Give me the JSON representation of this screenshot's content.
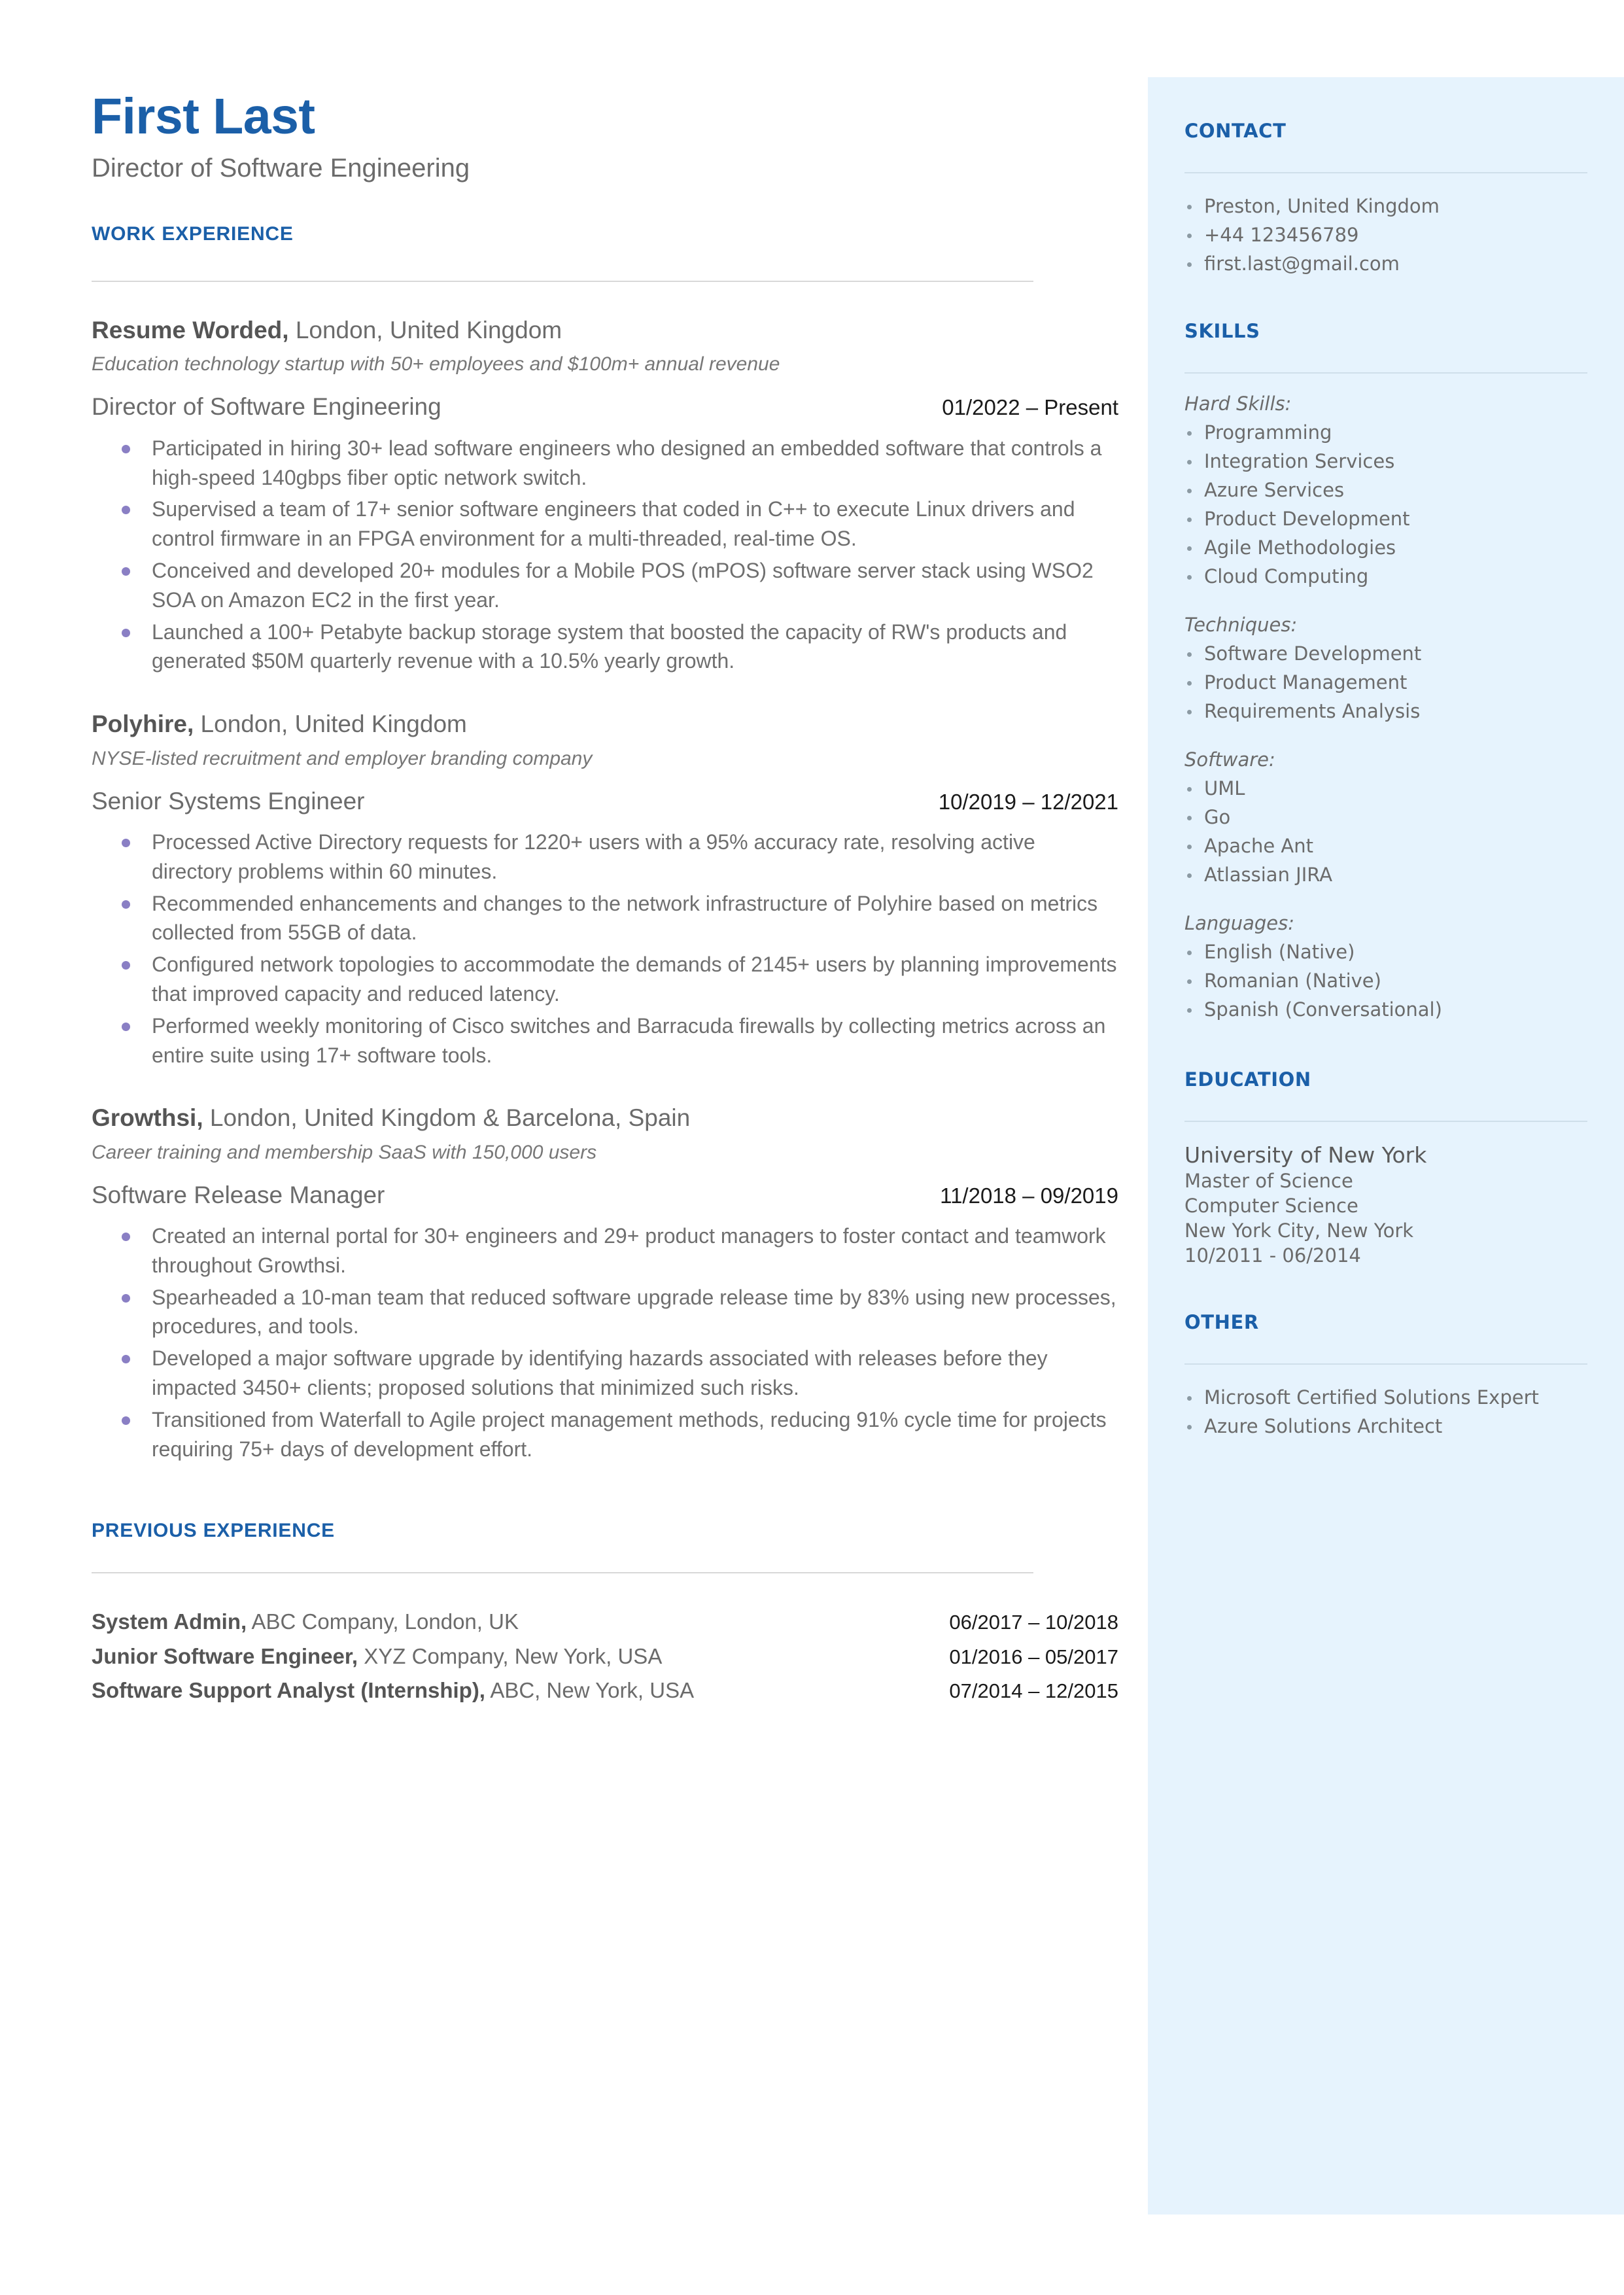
{
  "header": {
    "name": "First Last",
    "title": "Director of Software Engineering"
  },
  "colors": {
    "accent_blue": "#1b5fa8",
    "sidebar_bg": "#e6f3fd",
    "body_text": "#6b6b6b",
    "bullet_purple": "#8a7fc4"
  },
  "work_experience": {
    "heading": "WORK EXPERIENCE",
    "jobs": [
      {
        "company": "Resume Worded,",
        "location": " London, United Kingdom",
        "description": "Education technology startup with 50+ employees and $100m+ annual revenue",
        "role": "Director of Software Engineering",
        "dates": "01/2022 – Present",
        "bullets": [
          "Participated in hiring 30+ lead software engineers who designed an embedded software that controls a high-speed 140gbps fiber optic network switch.",
          "Supervised a team of 17+ senior software engineers that coded in C++ to execute Linux drivers and control firmware in an FPGA environment for a multi-threaded, real-time OS.",
          "Conceived and developed 20+ modules for a Mobile POS (mPOS) software server stack using WSO2 SOA on Amazon EC2 in the first year.",
          "Launched a 100+ Petabyte backup storage system that boosted the capacity of RW's products and generated $50M quarterly revenue with a 10.5% yearly growth."
        ]
      },
      {
        "company": "Polyhire,",
        "location": " London, United Kingdom",
        "description": "NYSE-listed recruitment and employer branding company",
        "role": "Senior Systems Engineer",
        "dates": "10/2019 – 12/2021",
        "bullets": [
          "Processed Active Directory requests for 1220+ users with a 95% accuracy rate, resolving active directory problems within 60 minutes.",
          "Recommended enhancements and changes to the network infrastructure of Polyhire based on metrics collected from 55GB of data.",
          "Configured network topologies to accommodate the demands of 2145+ users by planning improvements that improved capacity and reduced latency.",
          "Performed weekly monitoring of Cisco switches and Barracuda firewalls by collecting metrics across an entire suite using 17+ software tools."
        ]
      },
      {
        "company": "Growthsi,",
        "location": " London, United Kingdom & Barcelona, Spain",
        "description": "Career training and membership SaaS with 150,000 users",
        "role": "Software Release Manager",
        "dates": "11/2018 – 09/2019",
        "bullets": [
          "Created an internal portal for 30+ engineers and 29+ product managers to foster contact and teamwork throughout Growthsi.",
          "Spearheaded a 10-man team that reduced software upgrade release time by 83% using new processes, procedures, and tools.",
          "Developed a major software upgrade by identifying hazards associated with releases before they impacted 3450+ clients; proposed solutions that minimized such risks.",
          "Transitioned from Waterfall to Agile project management methods, reducing 91% cycle time for projects requiring 75+ days of development effort."
        ]
      }
    ]
  },
  "previous_experience": {
    "heading": "PREVIOUS EXPERIENCE",
    "entries": [
      {
        "role": "System Admin,",
        "detail": " ABC Company, London, UK",
        "dates": "06/2017 – 10/2018"
      },
      {
        "role": "Junior Software Engineer,",
        "detail": " XYZ Company, New York, USA",
        "dates": "01/2016 – 05/2017"
      },
      {
        "role": "Software Support Analyst (Internship),",
        "detail": " ABC, New York, USA",
        "dates": "07/2014 – 12/2015"
      }
    ]
  },
  "sidebar": {
    "contact": {
      "heading": "CONTACT",
      "items": [
        "Preston, United Kingdom",
        "+44 123456789",
        "first.last@gmail.com"
      ]
    },
    "skills": {
      "heading": "SKILLS",
      "groups": [
        {
          "label": "Hard Skills:",
          "items": [
            "Programming",
            "Integration Services",
            "Azure Services",
            "Product Development",
            "Agile Methodologies",
            "Cloud Computing"
          ]
        },
        {
          "label": "Techniques:",
          "items": [
            "Software Development",
            "Product Management",
            "Requirements Analysis"
          ]
        },
        {
          "label": "Software:",
          "items": [
            "UML",
            "Go",
            "Apache Ant",
            "Atlassian JIRA"
          ]
        },
        {
          "label": "Languages:",
          "items": [
            "English (Native)",
            "Romanian (Native)",
            "Spanish (Conversational)"
          ]
        }
      ]
    },
    "education": {
      "heading": "EDUCATION",
      "school": "University of New York",
      "degree": "Master of Science",
      "field": "Computer Science",
      "location": "New York City, New York",
      "dates": "10/2011 - 06/2014"
    },
    "other": {
      "heading": "OTHER",
      "items": [
        "Microsoft Certified Solutions Expert",
        "Azure Solutions Architect"
      ]
    }
  }
}
